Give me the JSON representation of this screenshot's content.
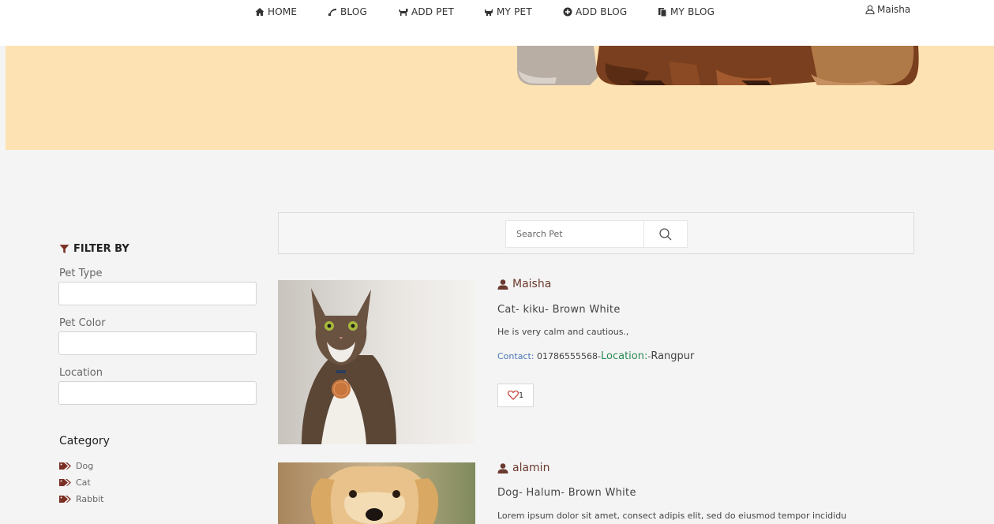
{
  "nav": {
    "items": [
      {
        "label": "HOME",
        "icon": "home-icon"
      },
      {
        "label": "BLOG",
        "icon": "blog-icon"
      },
      {
        "label": "ADD PET",
        "icon": "add-pet-icon"
      },
      {
        "label": "MY PET",
        "icon": "my-pet-icon"
      },
      {
        "label": "ADD BLOG",
        "icon": "plus-circle-icon"
      },
      {
        "label": "MY BLOG",
        "icon": "copy-icon"
      }
    ],
    "user": "Maisha"
  },
  "filter": {
    "title": "FILTER BY",
    "pet_type_label": "Pet Type",
    "pet_type_value": "",
    "pet_color_label": "Pet Color",
    "pet_color_value": "",
    "location_label": "Location",
    "location_value": "",
    "category_title": "Category",
    "categories": [
      "Dog",
      "Cat",
      "Rabbit"
    ]
  },
  "search": {
    "placeholder": "Search Pet",
    "value": ""
  },
  "pets": [
    {
      "owner": "Maisha",
      "meta": "Cat- kiku- Brown White",
      "description": "He is very calm and cautious.,",
      "contact_label": "Contact:",
      "contact_value": "01786555568",
      "location_label": "Location:",
      "location_value": "Rangpur",
      "likes": "1"
    },
    {
      "owner": "alamin",
      "meta": "Dog- Halum- Brown White",
      "description": "Lorem ipsum dolor sit amet, consect adipis elit, sed do eiusmod tempor incididu"
    }
  ],
  "colors": {
    "banner": "#fde3b3",
    "owner": "#6b3a2e",
    "contact": "#4a78b8",
    "location": "#2b8a55",
    "heart": "#c0392b"
  }
}
